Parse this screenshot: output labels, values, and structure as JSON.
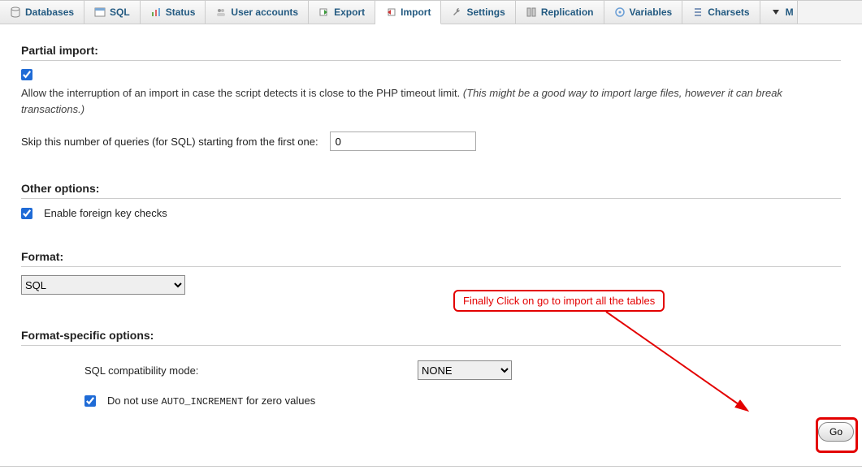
{
  "tabs": [
    {
      "label": "Databases",
      "icon": "db"
    },
    {
      "label": "SQL",
      "icon": "sql"
    },
    {
      "label": "Status",
      "icon": "status"
    },
    {
      "label": "User accounts",
      "icon": "users"
    },
    {
      "label": "Export",
      "icon": "export"
    },
    {
      "label": "Import",
      "icon": "import"
    },
    {
      "label": "Settings",
      "icon": "wrench"
    },
    {
      "label": "Replication",
      "icon": "replication"
    },
    {
      "label": "Variables",
      "icon": "vars"
    },
    {
      "label": "Charsets",
      "icon": "charsets"
    },
    {
      "label": "M",
      "icon": "triangle"
    }
  ],
  "active_tab": "Import",
  "partial_import": {
    "title": "Partial import:",
    "checkbox_checked": true,
    "desc_main": "Allow the interruption of an import in case the script detects it is close to the PHP timeout limit.",
    "desc_hint": "(This might be a good way to import large files, however it can break transactions.)",
    "skip_label": "Skip this number of queries (for SQL) starting from the first one:",
    "skip_value": "0"
  },
  "other_options": {
    "title": "Other options:",
    "fk_checked": true,
    "fk_label": "Enable foreign key checks"
  },
  "format": {
    "title": "Format:",
    "selected": "SQL"
  },
  "fso": {
    "title": "Format-specific options:",
    "compat_label": "SQL compatibility mode:",
    "compat_selected": "NONE",
    "autoinc_checked": true,
    "autoinc_prefix": "Do not use ",
    "autoinc_code": "AUTO_INCREMENT",
    "autoinc_suffix": " for zero values"
  },
  "go_label": "Go",
  "callout": "Finally Click on go to import all the tables"
}
